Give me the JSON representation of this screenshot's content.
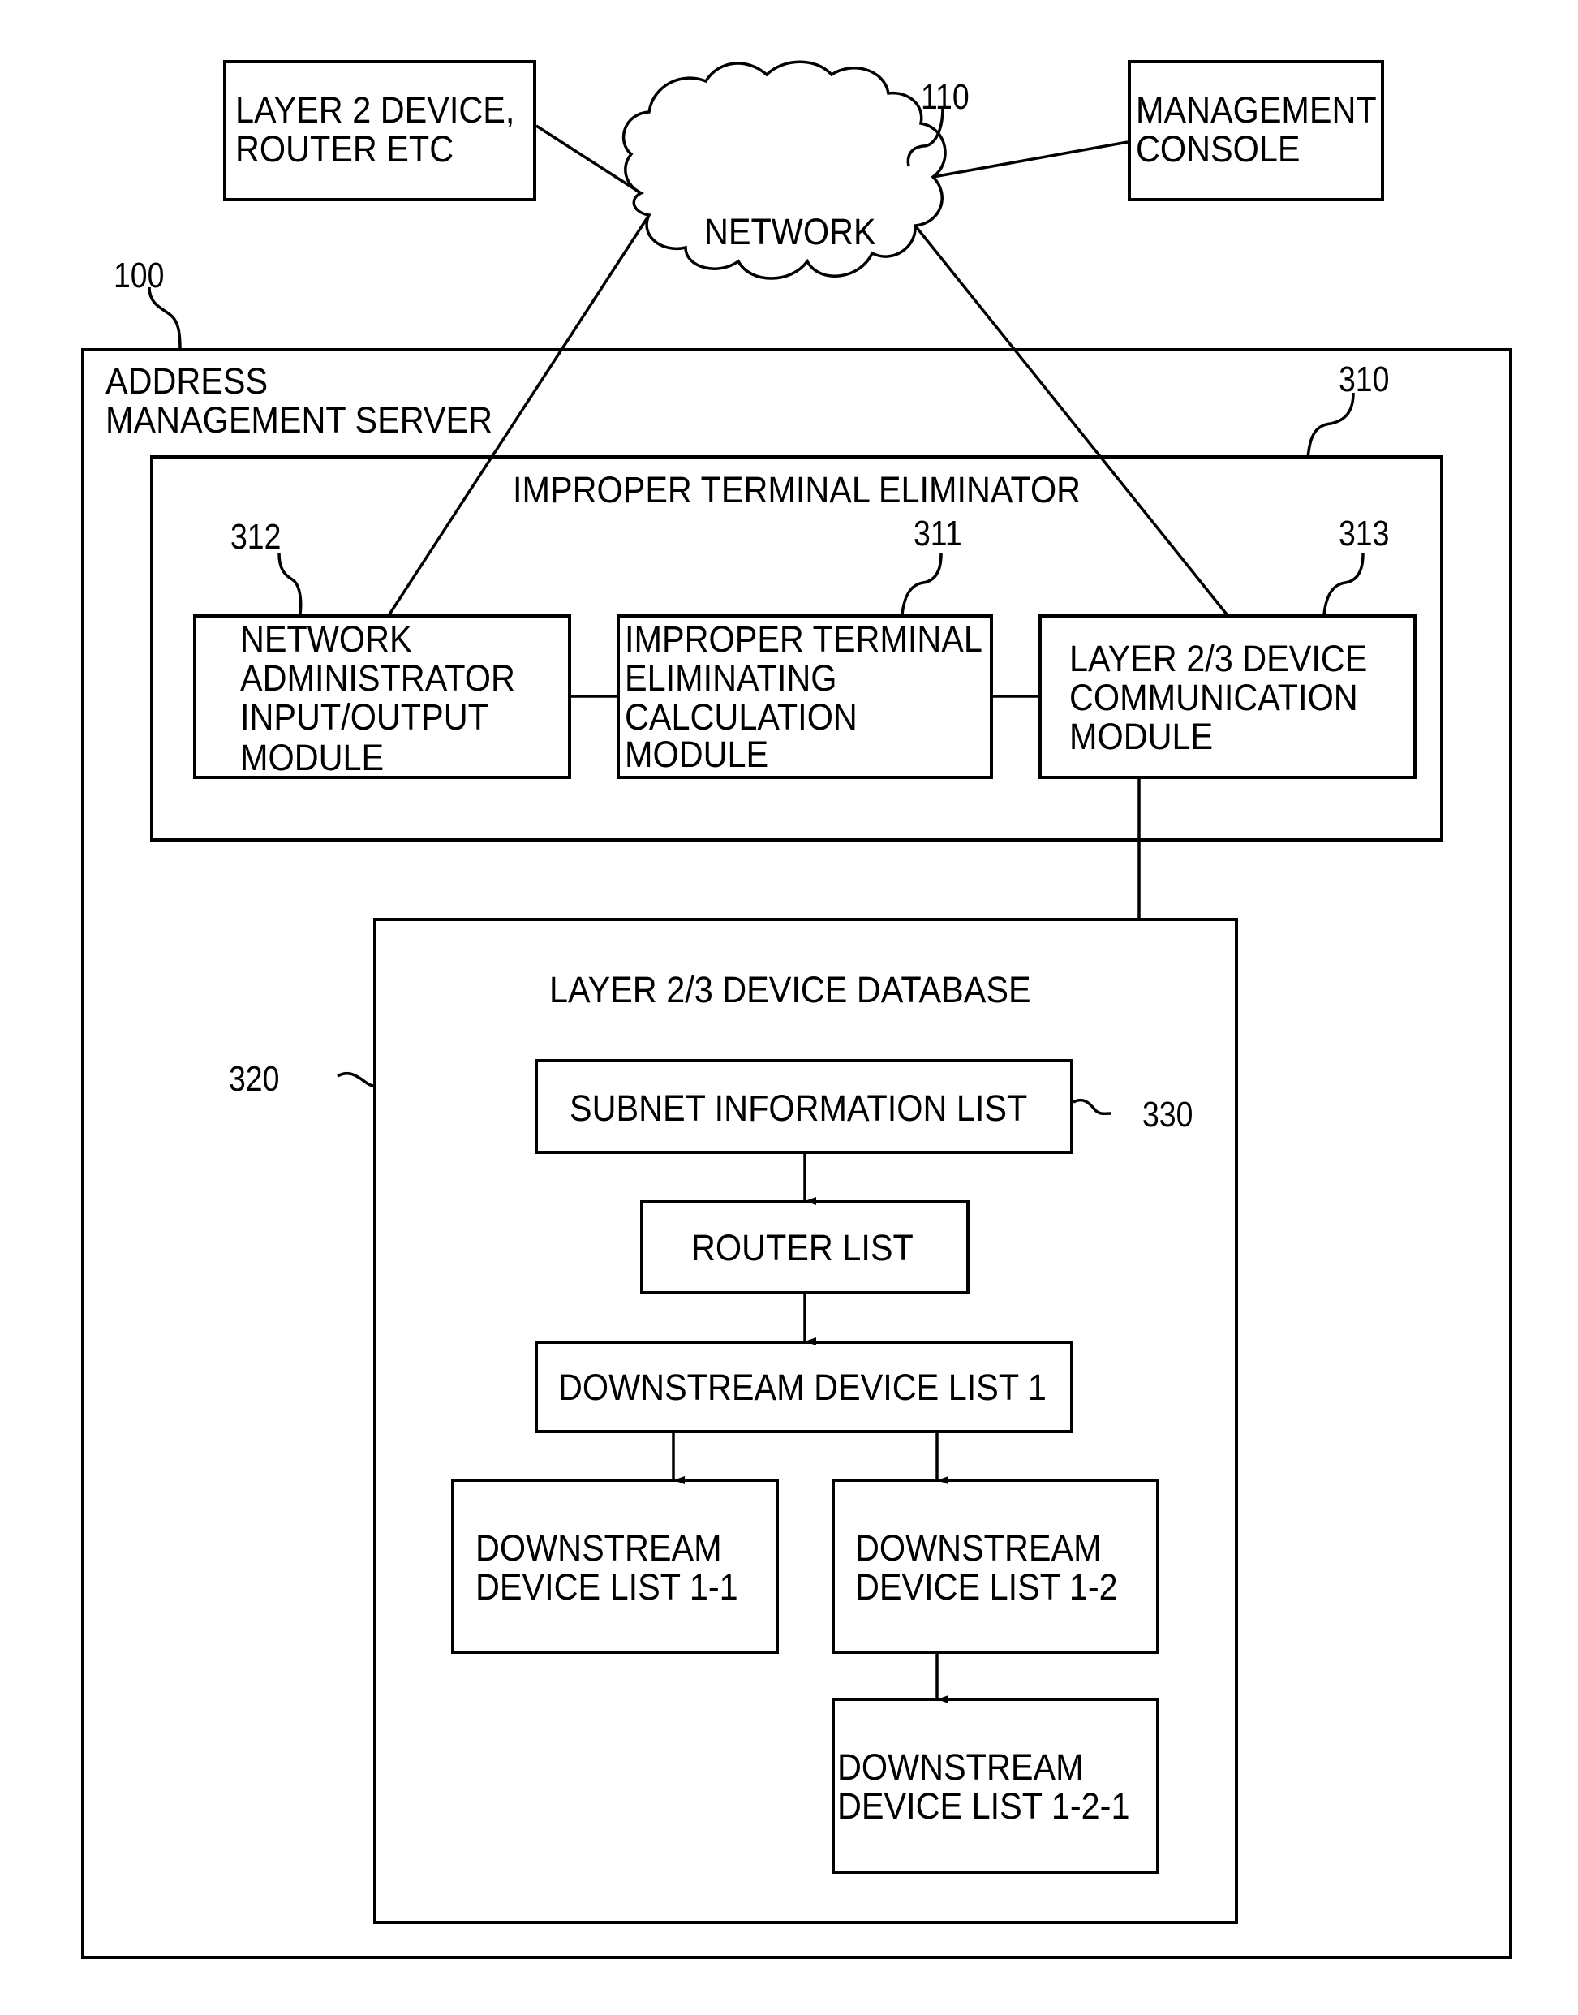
{
  "figure": {
    "external": {
      "layer2_device": {
        "lines": [
          "LAYER 2 DEVICE,",
          "ROUTER ETC"
        ]
      },
      "management_console": {
        "lines": [
          "MANAGEMENT",
          "CONSOLE"
        ]
      },
      "network": {
        "label": "NETWORK",
        "ref": "110"
      }
    },
    "server": {
      "ref": "100",
      "lines": [
        "ADDRESS",
        "MANAGEMENT SERVER"
      ],
      "eliminator": {
        "ref": "310",
        "title": "IMPROPER TERMINAL ELIMINATOR",
        "modules": [
          {
            "ref": "312",
            "lines": [
              "NETWORK",
              "ADMINISTRATOR",
              "INPUT/OUTPUT",
              "MODULE"
            ]
          },
          {
            "ref": "311",
            "lines": [
              "IMPROPER TERMINAL",
              "ELIMINATING",
              "CALCULATION",
              "MODULE"
            ]
          },
          {
            "ref": "313",
            "lines": [
              "LAYER 2/3 DEVICE",
              "COMMUNICATION",
              "MODULE"
            ]
          }
        ]
      },
      "database": {
        "ref": "320",
        "title": "LAYER 2/3 DEVICE DATABASE",
        "subnet_list": {
          "ref": "330",
          "label": "SUBNET INFORMATION LIST"
        },
        "router_list": {
          "label": "ROUTER LIST"
        },
        "downstream_1": {
          "label": "DOWNSTREAM DEVICE LIST 1"
        },
        "downstream_1_1": {
          "lines": [
            "DOWNSTREAM",
            "DEVICE LIST 1-1"
          ]
        },
        "downstream_1_2": {
          "lines": [
            "DOWNSTREAM",
            "DEVICE LIST 1-2"
          ]
        },
        "downstream_1_2_1": {
          "lines": [
            "DOWNSTREAM",
            "DEVICE LIST 1-2-1"
          ]
        }
      }
    }
  }
}
